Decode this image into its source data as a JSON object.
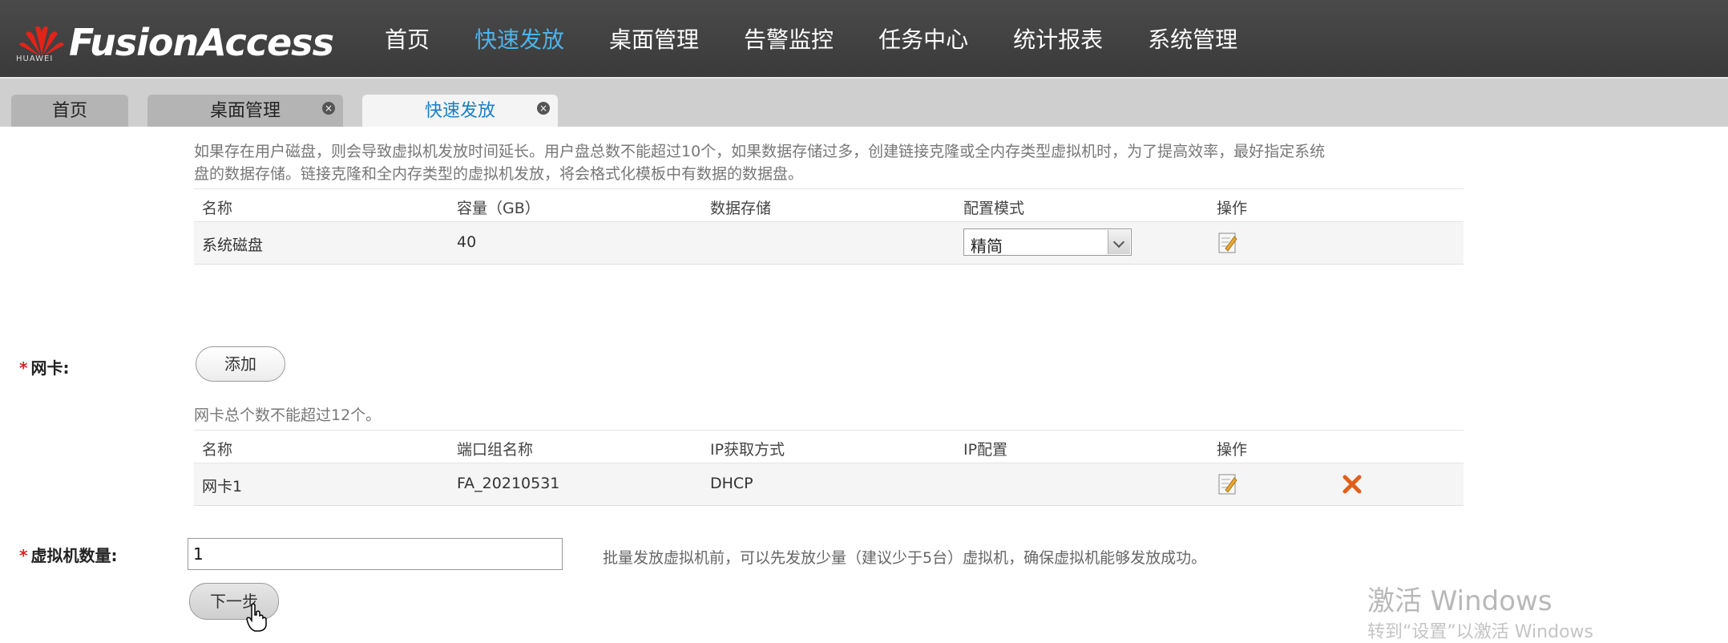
{
  "brand": {
    "name": "FusionAccess",
    "sub": "HUAWEI"
  },
  "nav": [
    {
      "label": "首页",
      "active": false
    },
    {
      "label": "快速发放",
      "active": true
    },
    {
      "label": "桌面管理",
      "active": false
    },
    {
      "label": "告警监控",
      "active": false
    },
    {
      "label": "任务中心",
      "active": false
    },
    {
      "label": "统计报表",
      "active": false
    },
    {
      "label": "系统管理",
      "active": false
    }
  ],
  "tabs": [
    {
      "label": "首页",
      "closable": false
    },
    {
      "label": "桌面管理",
      "closable": true
    },
    {
      "label": "快速发放",
      "closable": true,
      "active": true
    }
  ],
  "disk_note_line1": "如果存在用户磁盘，则会导致虚拟机发放时间延长。用户盘总数不能超过10个，如果数据存储过多，创建链接克隆或全内存类型虚拟机时，为了提高效率，最好指定系统",
  "disk_note_line2": "盘的数据存储。链接克隆和全内存类型的虚拟机发放，将会格式化模板中有数据的数据盘。",
  "disk_table": {
    "headers": [
      "名称",
      "容量（GB）",
      "数据存储",
      "配置模式",
      "操作"
    ],
    "row": {
      "name": "系统磁盘",
      "capacity": "40",
      "datastore": "",
      "mode": "精简"
    }
  },
  "nic": {
    "label": "网卡:",
    "add_button": "添加",
    "note": "网卡总个数不能超过12个。",
    "headers": [
      "名称",
      "端口组名称",
      "IP获取方式",
      "IP配置",
      "操作"
    ],
    "row": {
      "name": "网卡1",
      "port_group": "FA_20210531",
      "ip_mode": "DHCP",
      "ip_config": ""
    }
  },
  "vm_count": {
    "label": "虚拟机数量:",
    "value": "1",
    "hint": "批量发放虚拟机前，可以先发放少量（建议少于5台）虚拟机，确保虚拟机能够发放成功。"
  },
  "next_button": "下一步",
  "required_mark": "*",
  "close_glyph": "×",
  "watermark": {
    "line1": "激活 Windows",
    "line2": "转到“设置”以激活 Windows"
  },
  "colors": {
    "nav_active": "#4db3ea",
    "tab_active_text": "#1a7fc4",
    "delete_icon": "#e0601a"
  }
}
